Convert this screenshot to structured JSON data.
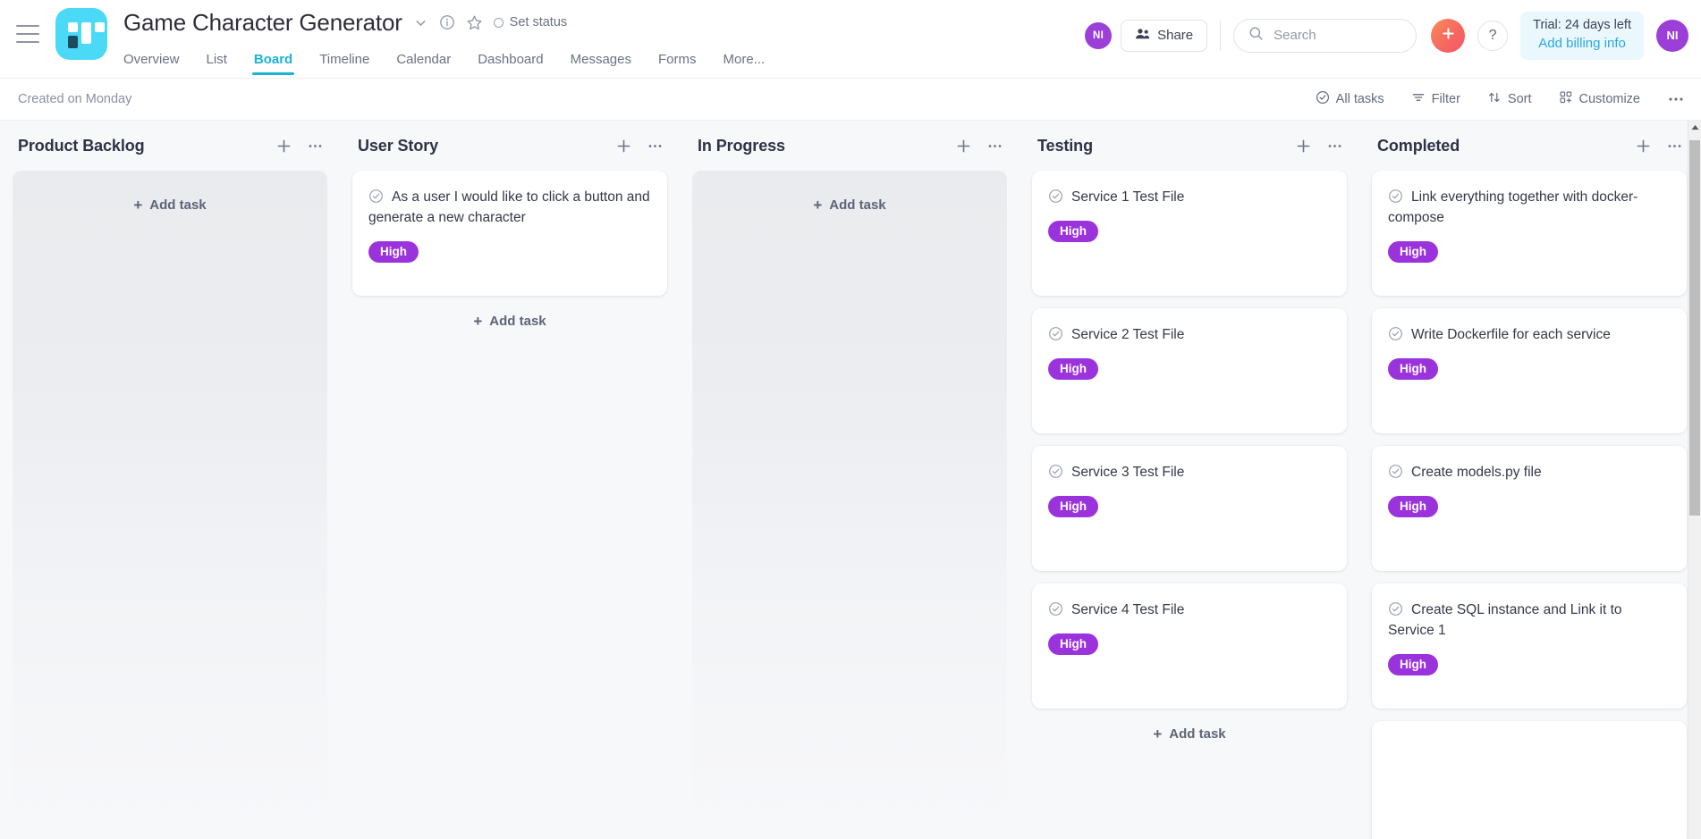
{
  "header": {
    "menu_icon": "hamburger-icon",
    "logo_icon": "app-logo-icon",
    "project_title": "Game Character Generator",
    "chevron_icon": "chevron-down-icon",
    "info_icon": "info-icon",
    "star_icon": "star-icon",
    "set_status_label": "Set status",
    "tabs": [
      {
        "label": "Overview",
        "active": false
      },
      {
        "label": "List",
        "active": false
      },
      {
        "label": "Board",
        "active": true
      },
      {
        "label": "Timeline",
        "active": false
      },
      {
        "label": "Calendar",
        "active": false
      },
      {
        "label": "Dashboard",
        "active": false
      },
      {
        "label": "Messages",
        "active": false
      },
      {
        "label": "Forms",
        "active": false
      },
      {
        "label": "More...",
        "active": false
      }
    ],
    "member_avatar": "NI",
    "share_label": "Share",
    "search_placeholder": "Search",
    "add_label": "+",
    "help_label": "?",
    "trial_text": "Trial: 24 days left",
    "billing_link": "Add billing info",
    "user_avatar": "NI",
    "accent_color": "#19b4d6",
    "logo_color": "#4ad9f7",
    "avatar_color": "#9b3fd8"
  },
  "toolbar": {
    "created_text": "Created on Monday",
    "all_tasks_label": "All tasks",
    "filter_label": "Filter",
    "sort_label": "Sort",
    "customize_label": "Customize",
    "more_icon": "ellipsis-icon"
  },
  "board": {
    "add_task_label": "Add task",
    "badge_color": "#9b33dd",
    "columns": [
      {
        "title": "Product Backlog",
        "empty": true,
        "cards": []
      },
      {
        "title": "User Story",
        "empty": false,
        "show_footer_add": true,
        "cards": [
          {
            "title": "As a user I would like to click a button and generate a new character",
            "priority": "High"
          }
        ]
      },
      {
        "title": "In Progress",
        "empty": true,
        "cards": []
      },
      {
        "title": "Testing",
        "empty": false,
        "show_footer_add": true,
        "cards": [
          {
            "title": "Service 1 Test File",
            "priority": "High"
          },
          {
            "title": "Service 2 Test File",
            "priority": "High"
          },
          {
            "title": "Service 3 Test File",
            "priority": "High"
          },
          {
            "title": "Service 4 Test File",
            "priority": "High"
          }
        ]
      },
      {
        "title": "Completed",
        "empty": false,
        "show_footer_add": false,
        "cards": [
          {
            "title": "Link everything together with docker-compose",
            "priority": "High"
          },
          {
            "title": "Write Dockerfile for each service",
            "priority": "High"
          },
          {
            "title": "Create models.py file",
            "priority": "High"
          },
          {
            "title": "Create SQL instance and Link it to Service 1",
            "priority": "High"
          },
          {
            "title": "",
            "priority": ""
          }
        ]
      }
    ]
  }
}
